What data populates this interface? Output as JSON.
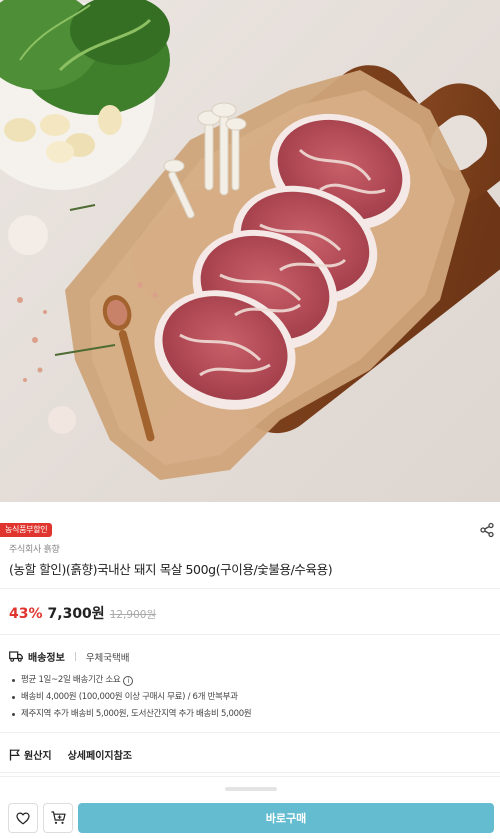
{
  "product": {
    "badge": "농식품부할인",
    "seller": "주식회사 흙향",
    "title": "(농할 할인)(흙향)국내산 돼지 목살 500g(구이용/숯불용/수육용)"
  },
  "price": {
    "discount": "43%",
    "sale": "7,300원",
    "original": "12,900원"
  },
  "shipping": {
    "label": "배송정보",
    "carrier": "우체국택배",
    "lines": [
      "평균 1일~2일 배송기간 소요",
      "배송비 4,000원 (100,000원 이상 구매시 무료) / 6개 반복부과",
      "제주지역 추가 배송비 5,000원, 도서산간지역 추가 배송비 5,000원"
    ]
  },
  "origin": {
    "label": "원산지",
    "value": "상세페이지참조"
  },
  "actions": {
    "buy_label": "바로구매"
  },
  "icons": {
    "share": "share-icon",
    "truck": "truck-icon",
    "flag": "flag-icon",
    "heart": "heart-icon",
    "cart": "cart-add-icon",
    "info": "info-icon"
  },
  "colors": {
    "accent_red": "#e0342f",
    "buy_button": "#64bcd0"
  }
}
